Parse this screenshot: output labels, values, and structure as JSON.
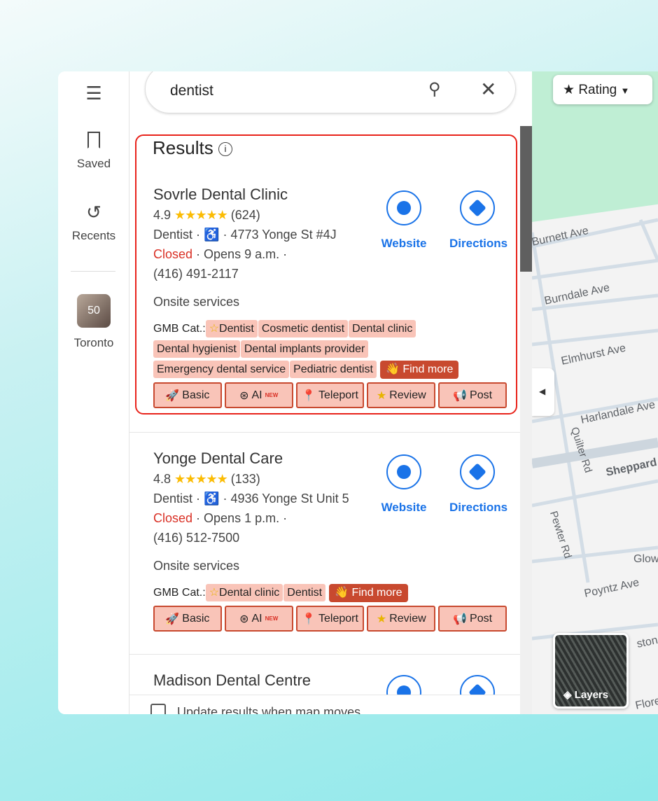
{
  "rail": {
    "saved": "Saved",
    "recents": "Recents",
    "place": "Toronto",
    "place_badge": "50"
  },
  "search": {
    "query": "dentist"
  },
  "results": {
    "heading": "Results",
    "items": [
      {
        "name": "Sovrle Dental Clinic",
        "rating": "4.9",
        "stars": "★★★★★",
        "reviews": "(624)",
        "type": "Dentist",
        "address": "4773 Yonge St #4J",
        "status": "Closed",
        "hours": "Opens 9 a.m.",
        "phone": "(416) 491-2117",
        "services": "Onsite services",
        "gmb_label": "GMB Cat.:",
        "categories": [
          "Dentist",
          "Cosmetic dentist",
          "Dental clinic",
          "Dental hygienist",
          "Dental implants provider",
          "Emergency dental service",
          "Pediatric dentist"
        ]
      },
      {
        "name": "Yonge Dental Care",
        "rating": "4.8",
        "stars": "★★★★★",
        "reviews": "(133)",
        "type": "Dentist",
        "address": "4936 Yonge St Unit 5",
        "status": "Closed",
        "hours": "Opens 1 p.m.",
        "phone": "(416) 512-7500",
        "services": "Onsite services",
        "gmb_label": "GMB Cat.:",
        "categories": [
          "Dental clinic",
          "Dentist"
        ]
      },
      {
        "name": "Madison Dental Centre"
      }
    ]
  },
  "actions": {
    "website": "Website",
    "directions": "Directions",
    "find_more": "Find more",
    "basic": "Basic",
    "ai": "AI",
    "ai_badge": "NEW",
    "teleport": "Teleport",
    "review": "Review",
    "post": "Post"
  },
  "footer": {
    "update_label": "Update results when map moves"
  },
  "map": {
    "rating_filter": "Rating",
    "layers": "Layers",
    "streets": [
      "Burnett Ave",
      "Burndale Ave",
      "Elmhurst Ave",
      "Harlandale Ave",
      "Quilter Rd",
      "Sheppard",
      "Pewter Rd",
      "Glow",
      "Poyntz Ave",
      "ston",
      "Floren"
    ]
  },
  "colors": {
    "accent": "#1a73e8",
    "closed": "#d93025",
    "tag": "#f9c4b8",
    "tag_strong": "#c8492f",
    "highlight": "#e8231b"
  }
}
